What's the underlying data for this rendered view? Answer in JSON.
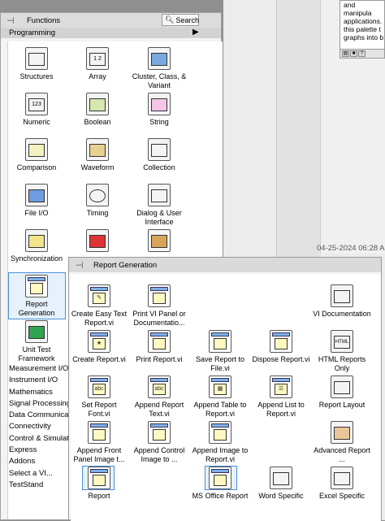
{
  "help_window": {
    "text_lines": [
      "and manipula",
      "applications.",
      "this palette t",
      "graphs into b"
    ],
    "toolbar_icons": [
      "show-help-icon",
      "lock-icon",
      "question-icon"
    ]
  },
  "timestamp": "04-25-2024 06:28 A",
  "functions_palette": {
    "title": "Functions",
    "search_label": "Search",
    "category": "Programming",
    "items": [
      {
        "label": "Structures",
        "icon": "structures-icon"
      },
      {
        "label": "Array",
        "icon": "array-icon"
      },
      {
        "label": "Cluster, Class, & Variant",
        "icon": "cluster-icon"
      },
      {
        "label": "Numeric",
        "icon": "numeric-icon"
      },
      {
        "label": "Boolean",
        "icon": "boolean-icon"
      },
      {
        "label": "String",
        "icon": "string-icon"
      },
      {
        "label": "Comparison",
        "icon": "comparison-icon"
      },
      {
        "label": "Waveform",
        "icon": "waveform-icon"
      },
      {
        "label": "Collection",
        "icon": "collection-icon"
      },
      {
        "label": "File I/O",
        "icon": "file-io-icon"
      },
      {
        "label": "Timing",
        "icon": "timing-icon"
      },
      {
        "label": "Dialog & User Interface",
        "icon": "dialog-icon"
      },
      {
        "label": "Synchronization",
        "icon": "synchronization-icon"
      },
      {
        "label": "",
        "icon": "graphics-sound-icon"
      },
      {
        "label": "",
        "icon": "application-control-icon"
      },
      {
        "label": "Report Generation",
        "icon": "report-generation-icon"
      },
      {
        "label": "Unit Test Framework",
        "icon": "unit-test-icon"
      }
    ],
    "list_items": [
      "Measurement I/O",
      "Instrument I/O",
      "Mathematics",
      "Signal Processing",
      "Data Communicati",
      "Connectivity",
      "Control & Simulati",
      "Express",
      "Addons",
      "Select a VI...",
      "TestStand"
    ]
  },
  "report_generation_palette": {
    "title": "Report Generation",
    "items": [
      {
        "label": "Create Easy Text Report.vi",
        "icon": "create-easy-text-report-icon"
      },
      {
        "label": "Print VI Panel or Documentatio...",
        "icon": "print-vi-panel-icon"
      },
      {
        "label": "VI Documentation",
        "icon": "vi-documentation-icon"
      },
      {
        "label": "Create Report.vi",
        "icon": "create-report-icon"
      },
      {
        "label": "Print Report.vi",
        "icon": "print-report-icon"
      },
      {
        "label": "Save Report to File.vi",
        "icon": "save-report-icon"
      },
      {
        "label": "Dispose Report.vi",
        "icon": "dispose-report-icon"
      },
      {
        "label": "HTML Reports Only",
        "icon": "html-reports-icon"
      },
      {
        "label": "Set Report Font.vi",
        "icon": "set-report-font-icon"
      },
      {
        "label": "Append Report Text.vi",
        "icon": "append-report-text-icon"
      },
      {
        "label": "Append Table to Report.vi",
        "icon": "append-table-icon"
      },
      {
        "label": "Append List to Report.vi",
        "icon": "append-list-icon"
      },
      {
        "label": "Report Layout",
        "icon": "report-layout-icon"
      },
      {
        "label": "Append Front Panel Image t...",
        "icon": "append-front-panel-icon"
      },
      {
        "label": "Append Control Image to ...",
        "icon": "append-control-image-icon"
      },
      {
        "label": "Append Image to Report.vi",
        "icon": "append-image-icon"
      },
      {
        "label": "Advanced Report ...",
        "icon": "advanced-report-icon"
      },
      {
        "label": "Report",
        "icon": "report-icon"
      },
      {
        "label": "MS Office Report",
        "icon": "ms-office-report-icon"
      },
      {
        "label": "Word Specific",
        "icon": "word-specific-icon"
      },
      {
        "label": "Excel Specific",
        "icon": "excel-specific-icon"
      }
    ]
  }
}
